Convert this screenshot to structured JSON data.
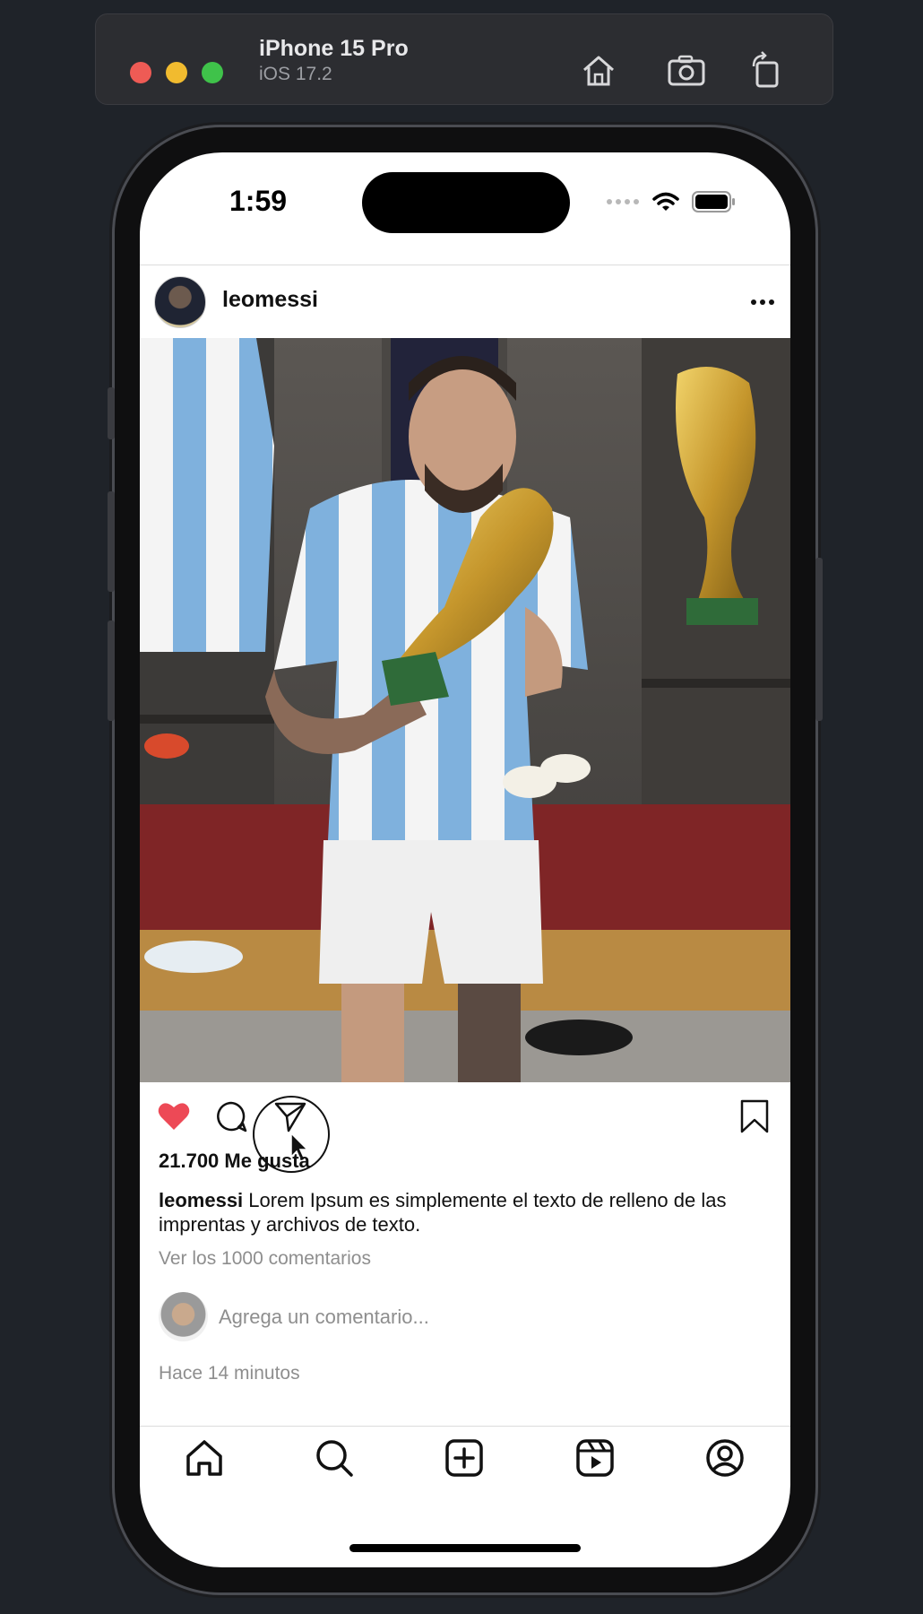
{
  "simulator": {
    "device_name": "iPhone 15 Pro",
    "os_version": "iOS 17.2",
    "icons": [
      "home-icon",
      "screenshot-icon",
      "rotate-icon"
    ]
  },
  "status_bar": {
    "time": "1:59"
  },
  "post": {
    "username": "leomessi",
    "likes": "21.700 Me gusta",
    "caption_user": "leomessi",
    "caption_text": " Lorem Ipsum es simplemente el texto de relleno de las imprentas y archivos de texto.",
    "view_comments": "Ver los 1000 comentarios",
    "comment_placeholder": "Agrega un comentario...",
    "timestamp": "Hace 14 minutos",
    "liked": true
  },
  "colors": {
    "like_red": "#ed4956",
    "muted_text": "#8e8e8e"
  },
  "tab_bar": [
    "home-icon",
    "search-icon",
    "add-post-icon",
    "reels-icon",
    "profile-icon"
  ]
}
